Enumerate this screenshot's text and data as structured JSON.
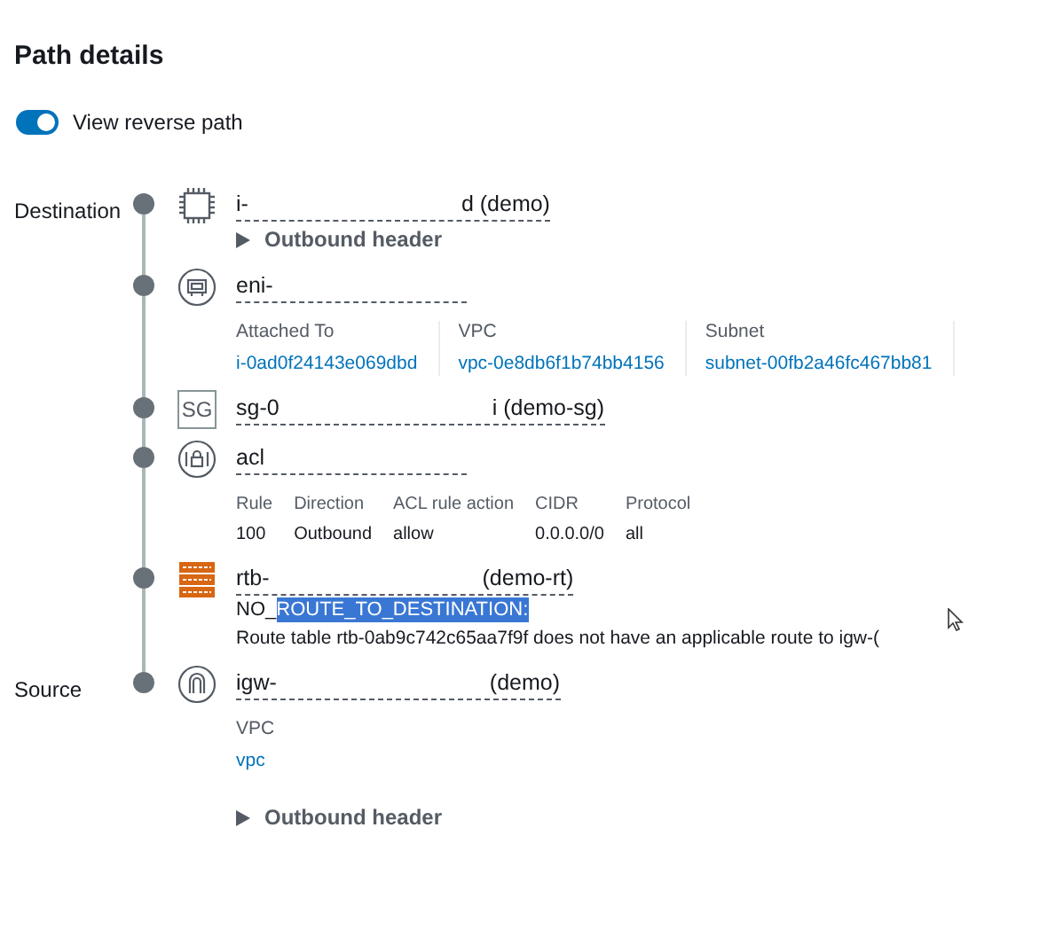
{
  "title": "Path details",
  "reverse_toggle": {
    "label": "View reverse path",
    "on": true
  },
  "steps": [
    {
      "kind": "instance",
      "role_label": "Destination",
      "name_left": "i-",
      "name_right": "d (demo)",
      "expander": {
        "label": "Outbound header",
        "expanded": false
      }
    },
    {
      "kind": "eni",
      "name_left": "eni-",
      "details": {
        "columns": [
          {
            "label": "Attached To",
            "value": "i-0ad0f24143e069dbd"
          },
          {
            "label": "VPC",
            "value": "vpc-0e8db6f1b74bb4156"
          },
          {
            "label": "Subnet",
            "value": "subnet-00fb2a46fc467bb81"
          }
        ]
      }
    },
    {
      "kind": "sg",
      "icon_text": "SG",
      "name_left": "sg-0",
      "name_right": "i (demo-sg)"
    },
    {
      "kind": "acl",
      "name_left": "acl",
      "rules": {
        "headers": [
          "Rule",
          "Direction",
          "ACL rule action",
          "CIDR",
          "Protocol"
        ],
        "rows": [
          [
            "100",
            "Outbound",
            "allow",
            "0.0.0.0/0",
            "all"
          ]
        ]
      }
    },
    {
      "kind": "rtb",
      "name_left": "rtb-",
      "name_right": "(demo-rt)",
      "error": {
        "prefix": "NO_",
        "rest": "ROUTE_TO_DESTINATION:",
        "highlighted": true,
        "message": "Route table rtb-0ab9c742c65aa7f9f does not have an applicable route to igw-("
      }
    },
    {
      "kind": "igw",
      "role_label": "Source",
      "name_left": "igw-",
      "name_right": "(demo)",
      "details": {
        "columns": [
          {
            "label": "VPC",
            "value": "vpc"
          }
        ]
      },
      "expander": {
        "label": "Outbound header",
        "expanded": false
      }
    }
  ]
}
